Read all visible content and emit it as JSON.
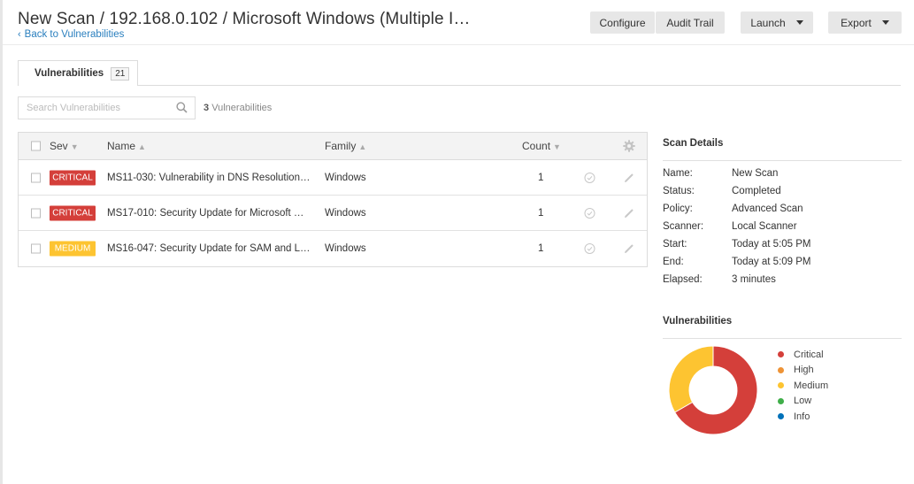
{
  "header": {
    "title": "New Scan / 192.168.0.102 / Microsoft Windows (Multiple I…",
    "back_link": "Back to Vulnerabilities",
    "buttons": {
      "configure": "Configure",
      "audit_trail": "Audit Trail",
      "launch": "Launch",
      "export": "Export"
    }
  },
  "tabs": [
    {
      "label": "Vulnerabilities",
      "count": "21"
    }
  ],
  "search": {
    "placeholder": "Search Vulnerabilities",
    "count_number": "3",
    "count_label": "Vulnerabilities"
  },
  "table": {
    "columns": {
      "sev": "Sev",
      "name": "Name",
      "family": "Family",
      "count": "Count"
    },
    "rows": [
      {
        "severity": "CRITICAL",
        "name": "MS11-030: Vulnerability in DNS Resolution…",
        "family": "Windows",
        "count": "1"
      },
      {
        "severity": "CRITICAL",
        "name": "MS17-010: Security Update for Microsoft …",
        "family": "Windows",
        "count": "1"
      },
      {
        "severity": "MEDIUM",
        "name": "MS16-047: Security Update for SAM and L…",
        "family": "Windows",
        "count": "1"
      }
    ]
  },
  "scan_details": {
    "title": "Scan Details",
    "items": [
      {
        "key": "Name:",
        "value": "New Scan"
      },
      {
        "key": "Status:",
        "value": "Completed"
      },
      {
        "key": "Policy:",
        "value": "Advanced Scan"
      },
      {
        "key": "Scanner:",
        "value": "Local Scanner"
      },
      {
        "key": "Start:",
        "value": "Today at 5:05 PM"
      },
      {
        "key": "End:",
        "value": "Today at 5:09 PM"
      },
      {
        "key": "Elapsed:",
        "value": "3 minutes"
      }
    ]
  },
  "vulnerabilities_chart": {
    "title": "Vulnerabilities",
    "legend": [
      {
        "label": "Critical",
        "color": "#d43f3a"
      },
      {
        "label": "High",
        "color": "#ee9336"
      },
      {
        "label": "Medium",
        "color": "#fdc431"
      },
      {
        "label": "Low",
        "color": "#3fae49"
      },
      {
        "label": "Info",
        "color": "#0071b9"
      }
    ]
  },
  "chart_data": {
    "type": "pie",
    "categories": [
      "Critical",
      "High",
      "Medium",
      "Low",
      "Info"
    ],
    "values": [
      2,
      0,
      1,
      0,
      0
    ],
    "colors": [
      "#d43f3a",
      "#ee9336",
      "#fdc431",
      "#3fae49",
      "#0071b9"
    ],
    "title": "Vulnerabilities",
    "donut": true,
    "legend": "right"
  },
  "colors": {
    "link": "#2a7fbe",
    "critical": "#d43f3a",
    "medium": "#fdc431"
  }
}
